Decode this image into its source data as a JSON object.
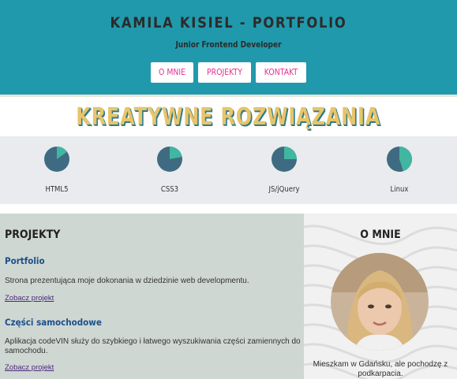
{
  "header": {
    "title": "KAMILA KISIEL - PORTFOLIO",
    "subtitle": "Junior Frontend Developer",
    "nav": [
      "O MNIE",
      "PROJEKTY",
      "KONTAKT"
    ]
  },
  "hero": {
    "title": "KREATYWNE ROZWIĄZANIA"
  },
  "skills": [
    {
      "label": "HTML5",
      "level": 0.15
    },
    {
      "label": "CSS3",
      "level": 0.22
    },
    {
      "label": "JS/jQuery",
      "level": 0.25
    },
    {
      "label": "Linux",
      "level": 0.45
    }
  ],
  "projects": {
    "title": "PROJEKTY",
    "items": [
      {
        "name": "Portfolio",
        "description": "Strona prezentująca moje dokonania w dziedzinie web developmentu.",
        "link": "Zobacz projekt"
      },
      {
        "name": "Części samochodowe",
        "description": "Aplikacja codeVIN służy do szybkiego i łatwego wyszukiwania części zamiennych do samochodu.",
        "link": "Zobacz projekt"
      }
    ]
  },
  "about": {
    "title": "O MNIE",
    "text": "Mieszkam w Gdańsku, ale pochodzę z podkarpacia."
  },
  "colors": {
    "header_bg": "#2199ac",
    "accent_pink": "#e0338f",
    "hero_gold": "#e8c46a",
    "pie_main": "#3f6b82",
    "pie_slice": "#41b6a0"
  }
}
